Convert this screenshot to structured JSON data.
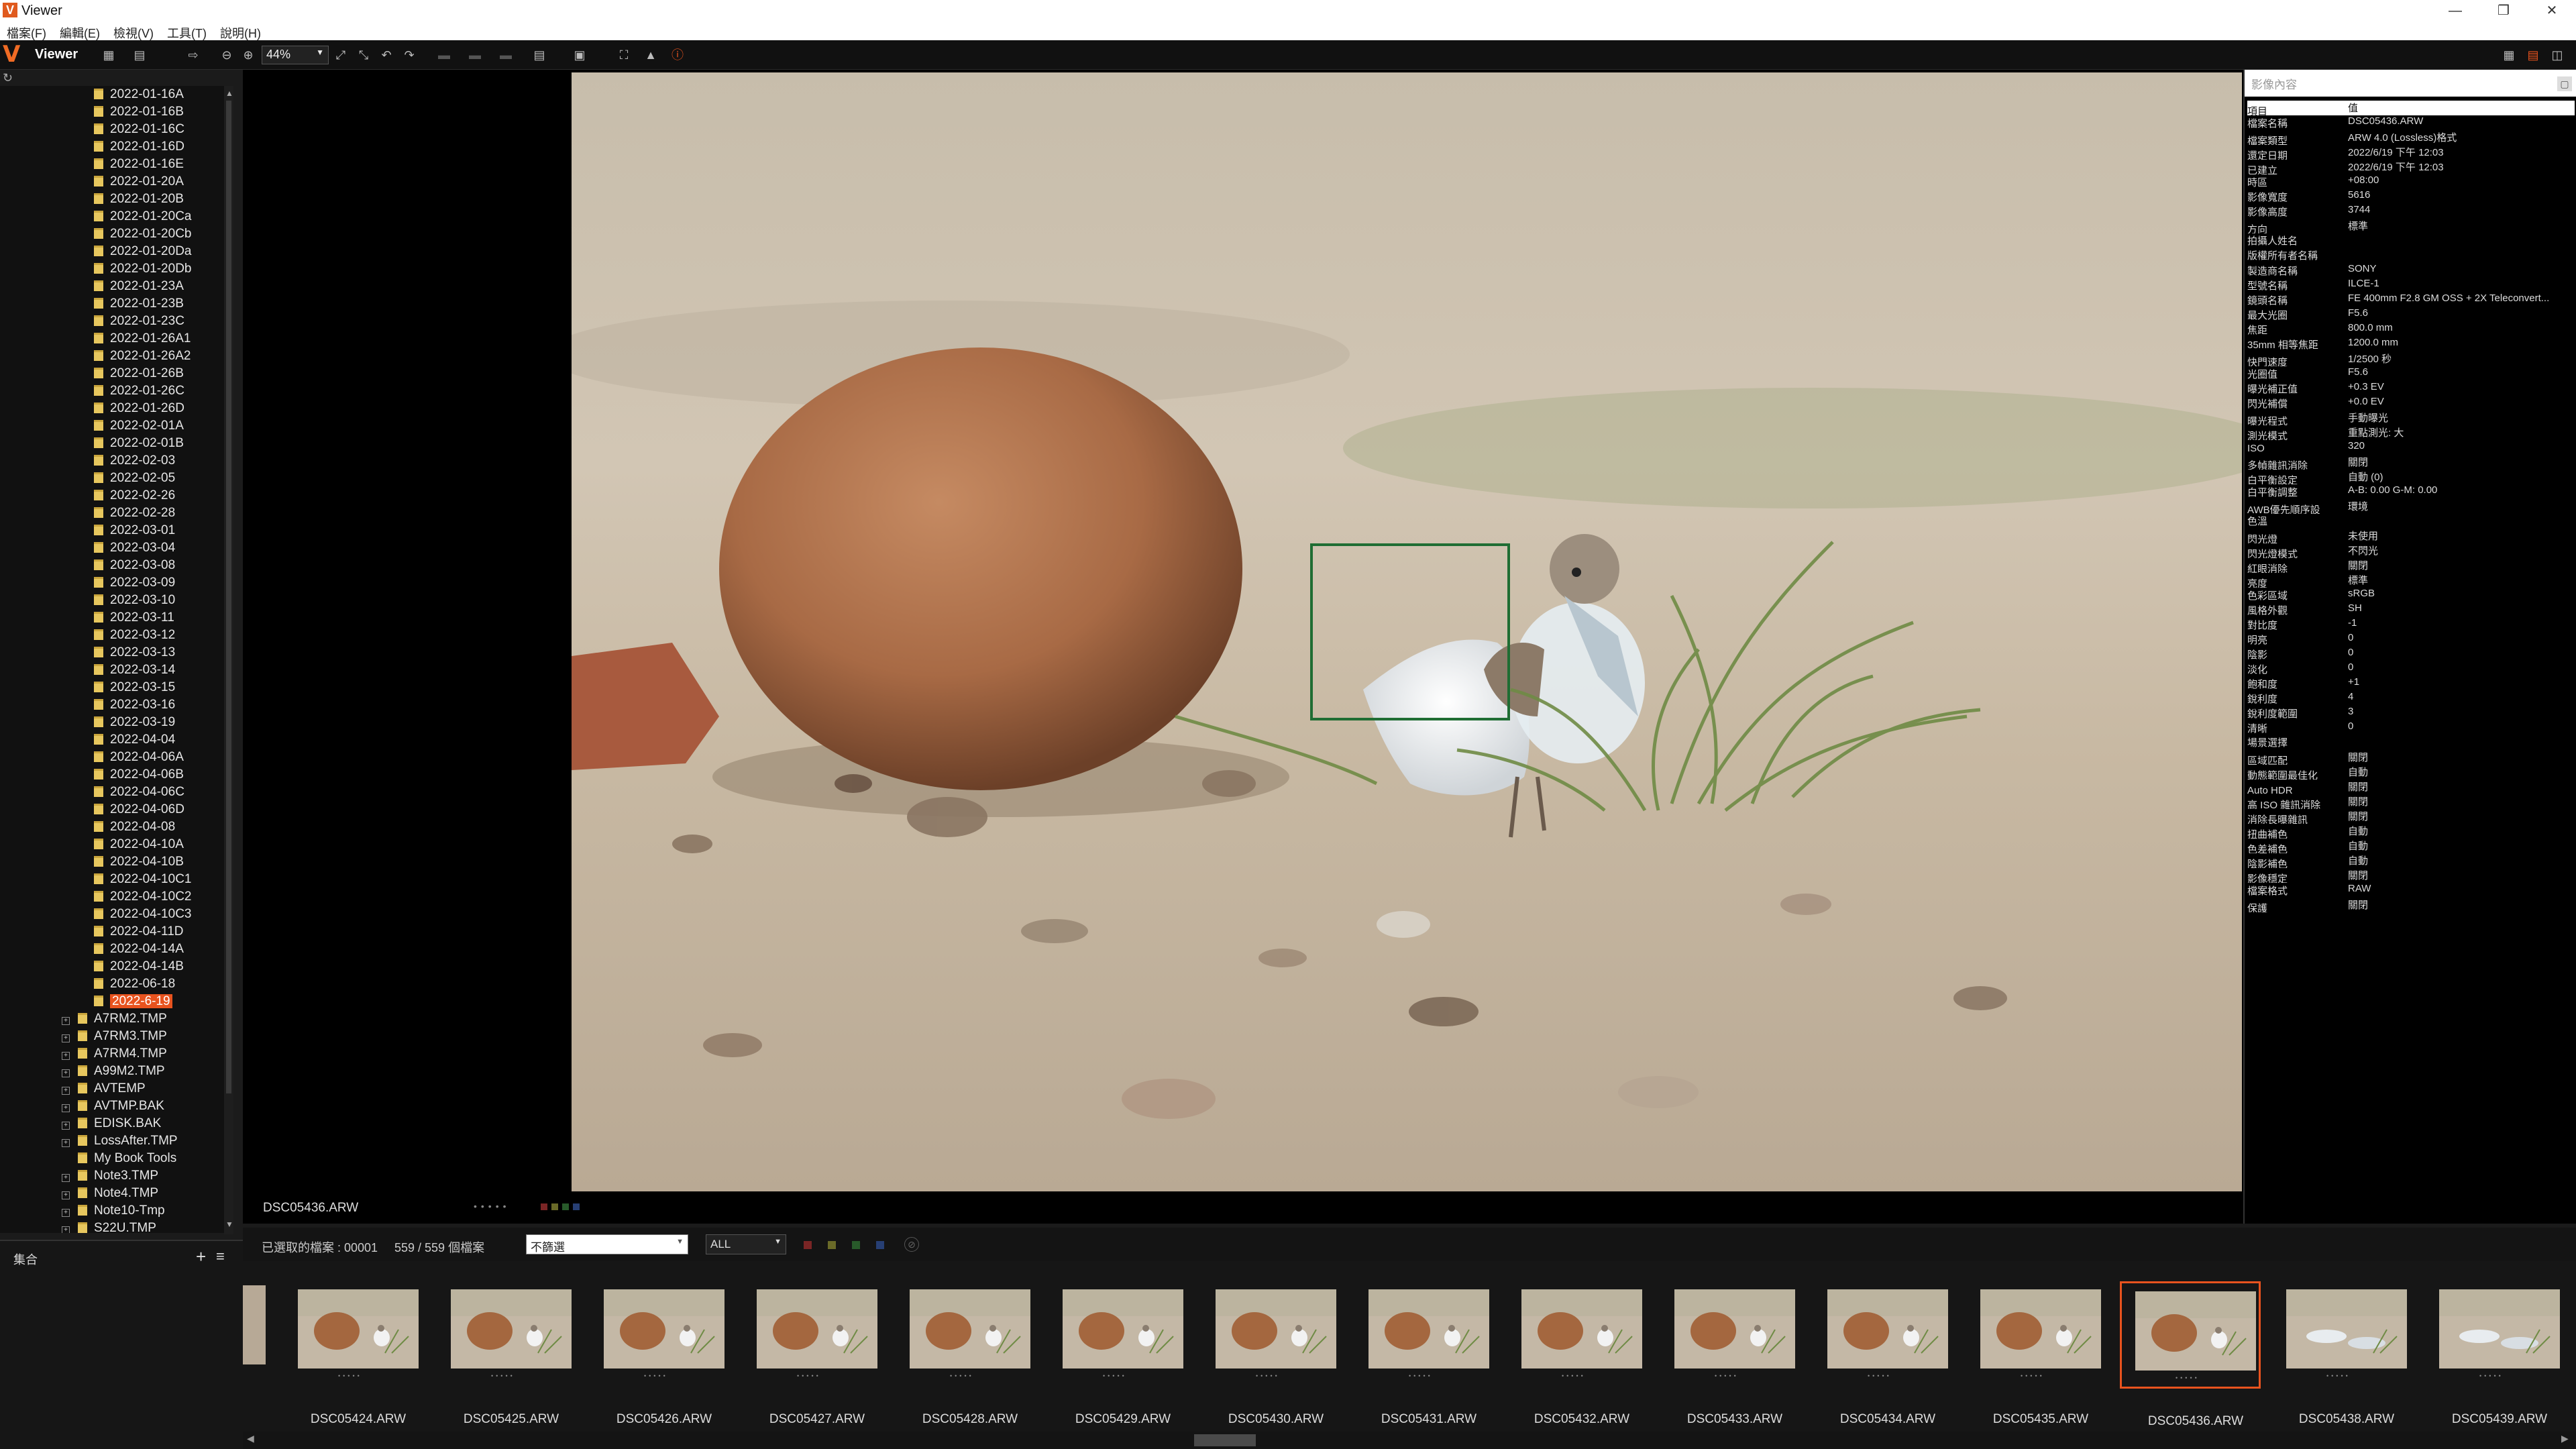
{
  "window": {
    "title": "Viewer"
  },
  "menu": [
    "檔案(F)",
    "編輯(E)",
    "檢視(V)",
    "工具(T)",
    "說明(H)"
  ],
  "toolbar": {
    "title": "Viewer",
    "zoom": "44%"
  },
  "tree": {
    "dates": [
      "2022-01-16A",
      "2022-01-16B",
      "2022-01-16C",
      "2022-01-16D",
      "2022-01-16E",
      "2022-01-20A",
      "2022-01-20B",
      "2022-01-20Ca",
      "2022-01-20Cb",
      "2022-01-20Da",
      "2022-01-20Db",
      "2022-01-23A",
      "2022-01-23B",
      "2022-01-23C",
      "2022-01-26A1",
      "2022-01-26A2",
      "2022-01-26B",
      "2022-01-26C",
      "2022-01-26D",
      "2022-02-01A",
      "2022-02-01B",
      "2022-02-03",
      "2022-02-05",
      "2022-02-26",
      "2022-02-28",
      "2022-03-01",
      "2022-03-04",
      "2022-03-08",
      "2022-03-09",
      "2022-03-10",
      "2022-03-11",
      "2022-03-12",
      "2022-03-13",
      "2022-03-14",
      "2022-03-15",
      "2022-03-16",
      "2022-03-19",
      "2022-04-04",
      "2022-04-06A",
      "2022-04-06B",
      "2022-04-06C",
      "2022-04-06D",
      "2022-04-08",
      "2022-04-10A",
      "2022-04-10B",
      "2022-04-10C1",
      "2022-04-10C2",
      "2022-04-10C3",
      "2022-04-11D",
      "2022-04-14A",
      "2022-04-14B",
      "2022-06-18",
      "2022-6-19"
    ],
    "selected": "2022-6-19",
    "roots": [
      {
        "label": "A7RM2.TMP",
        "exp": true
      },
      {
        "label": "A7RM3.TMP",
        "exp": true
      },
      {
        "label": "A7RM4.TMP",
        "exp": true
      },
      {
        "label": "A99M2.TMP",
        "exp": true
      },
      {
        "label": "AVTEMP",
        "exp": true
      },
      {
        "label": "AVTMP.BAK",
        "exp": true
      },
      {
        "label": "EDISK.BAK",
        "exp": true
      },
      {
        "label": "LossAfter.TMP",
        "exp": true
      },
      {
        "label": "My Book Tools",
        "exp": false
      },
      {
        "label": "Note3.TMP",
        "exp": true
      },
      {
        "label": "Note4.TMP",
        "exp": true
      },
      {
        "label": "Note10-Tmp",
        "exp": true
      },
      {
        "label": "S22U.TMP",
        "exp": true
      }
    ]
  },
  "collection": {
    "title": "集合"
  },
  "viewer": {
    "filename": "DSC05436.ARW"
  },
  "info": {
    "title": "影像內容",
    "col_item": "項目",
    "col_value": "值",
    "rows": [
      [
        "檔案名稱",
        "DSC05436.ARW"
      ],
      [
        "檔案類型",
        "ARW 4.0 (Lossless)格式"
      ],
      [
        "還定日期",
        "2022/6/19 下午 12:03"
      ],
      [
        "已建立",
        "2022/6/19 下午 12:03"
      ],
      [
        "時區",
        "+08:00"
      ],
      [
        "影像寬度",
        "5616"
      ],
      [
        "影像高度",
        "3744"
      ],
      [
        "方向",
        "標準"
      ],
      [
        "拍攝人姓名",
        ""
      ],
      [
        "版權所有者名稱",
        ""
      ],
      [
        "製造商名稱",
        "SONY"
      ],
      [
        "型號名稱",
        "ILCE-1"
      ],
      [
        "鏡頭名稱",
        "FE 400mm F2.8 GM OSS + 2X Teleconvert..."
      ],
      [
        "最大光圈",
        "F5.6"
      ],
      [
        "焦距",
        "800.0 mm"
      ],
      [
        "35mm 相等焦距",
        "1200.0 mm"
      ],
      [
        "快門速度",
        "1/2500 秒"
      ],
      [
        "光圈值",
        "F5.6"
      ],
      [
        "曝光補正值",
        "+0.3 EV"
      ],
      [
        "閃光補償",
        "+0.0 EV"
      ],
      [
        "曝光程式",
        "手動曝光"
      ],
      [
        "測光模式",
        "重點測光: 大"
      ],
      [
        "ISO",
        "320"
      ],
      [
        "多幀雜訊消除",
        "關閉"
      ],
      [
        "白平衡設定",
        "自動 (0)"
      ],
      [
        "白平衡調整",
        "A-B: 0.00 G-M: 0.00"
      ],
      [
        "AWB優先順序設",
        "環境"
      ],
      [
        "色溫",
        ""
      ],
      [
        "閃光燈",
        "未使用"
      ],
      [
        "閃光燈模式",
        "不閃光"
      ],
      [
        "紅眼消除",
        "關閉"
      ],
      [
        "亮度",
        "標準"
      ],
      [
        "色彩區域",
        "sRGB"
      ],
      [
        "風格外觀",
        "SH"
      ],
      [
        "對比度",
        "-1"
      ],
      [
        "明亮",
        "0"
      ],
      [
        "陰影",
        "0"
      ],
      [
        "淡化",
        "0"
      ],
      [
        "飽和度",
        "+1"
      ],
      [
        "銳利度",
        "4"
      ],
      [
        "銳利度範圍",
        "3"
      ],
      [
        "清晰",
        "0"
      ],
      [
        "場景選擇",
        ""
      ],
      [
        "區域匹配",
        "關閉"
      ],
      [
        "動態範圍最佳化",
        "自動"
      ],
      [
        "Auto HDR",
        "關閉"
      ],
      [
        "高 ISO 雜訊消除",
        "關閉"
      ],
      [
        "消除長曝雜訊",
        "關閉"
      ],
      [
        "扭曲補色",
        "自動"
      ],
      [
        "色差補色",
        "自動"
      ],
      [
        "陰影補色",
        "自動"
      ],
      [
        "影像穩定",
        "關閉"
      ],
      [
        "檔案格式",
        "RAW"
      ],
      [
        "保護",
        "關閉"
      ]
    ]
  },
  "status": {
    "selected": "已選取的檔案 : 00001",
    "count": "559 / 559 個檔案",
    "filter": "不篩選",
    "all": "ALL"
  },
  "filmstrip": [
    "DSC05424.ARW",
    "DSC05425.ARW",
    "DSC05426.ARW",
    "DSC05427.ARW",
    "DSC05428.ARW",
    "DSC05429.ARW",
    "DSC05430.ARW",
    "DSC05431.ARW",
    "DSC05432.ARW",
    "DSC05433.ARW",
    "DSC05434.ARW",
    "DSC05435.ARW",
    "DSC05436.ARW",
    "DSC05438.ARW",
    "DSC05439.ARW"
  ],
  "filmstrip_current": "DSC05436.ARW",
  "colors": {
    "accent": "#e8531e",
    "focus": "#1f6d33"
  }
}
